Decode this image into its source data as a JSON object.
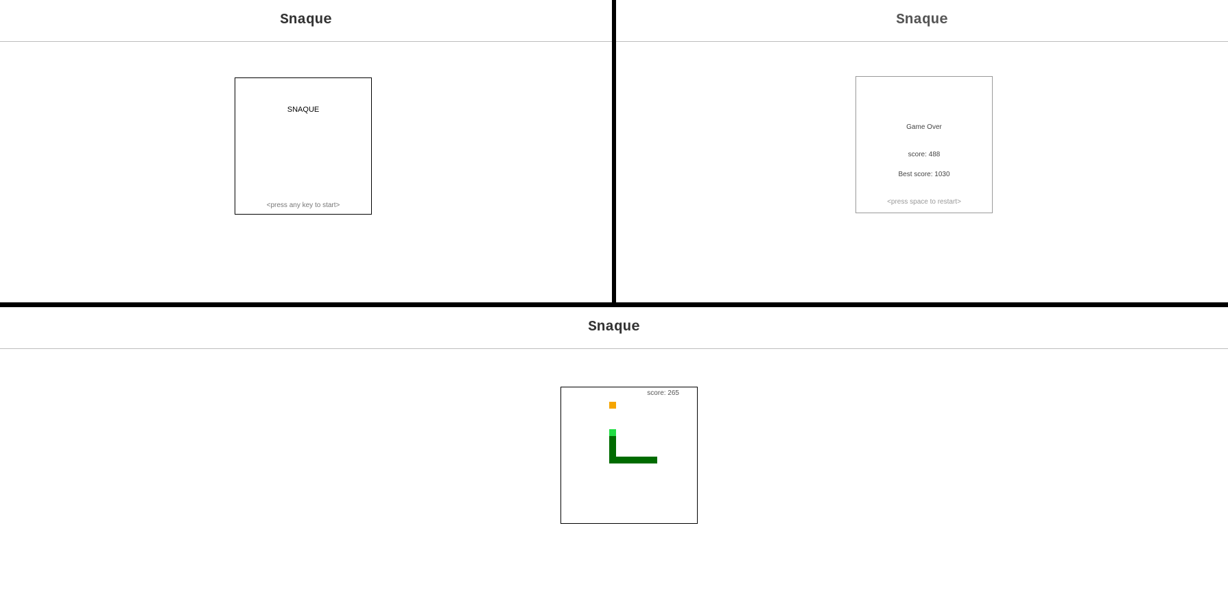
{
  "panels": {
    "start": {
      "title": "Snaque",
      "heading": "SNAQUE",
      "prompt": "<press any key to start>"
    },
    "gameover": {
      "title": "Snaque",
      "heading": "Game Over",
      "score_text": "score: 488",
      "best_text": "Best score: 1030",
      "prompt": "<press space to restart>"
    },
    "playing": {
      "title": "Snaque",
      "score_text": "score: 265"
    }
  },
  "colors": {
    "snake_body": "#006b00",
    "snake_head": "#22dd44",
    "food": "#f5a500"
  }
}
